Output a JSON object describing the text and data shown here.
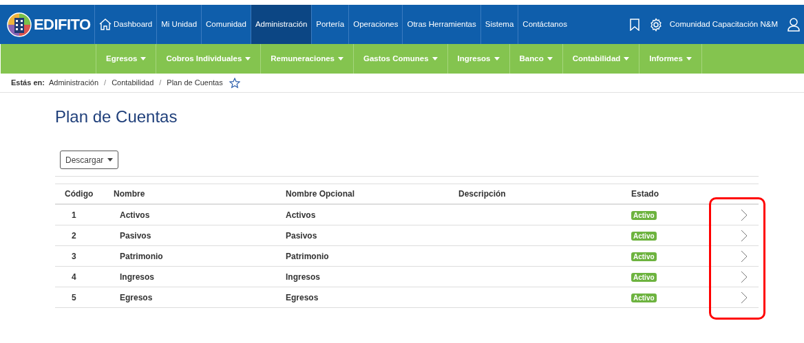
{
  "brand": {
    "name": "EDIFITO"
  },
  "top_nav": [
    {
      "label": "Dashboard",
      "kind": "home",
      "selected": false
    },
    {
      "label": "Mi Unidad",
      "selected": false
    },
    {
      "label": "Comunidad",
      "selected": false
    },
    {
      "label": "Administración",
      "selected": true
    },
    {
      "label": "Portería",
      "selected": false
    },
    {
      "label": "Operaciones",
      "selected": false
    },
    {
      "label": "Otras Herramientas",
      "selected": false
    },
    {
      "label": "Sistema",
      "selected": false
    },
    {
      "label": "Contáctanos",
      "selected": false
    }
  ],
  "user": {
    "community": "Comunidad Capacitación N&M"
  },
  "sub_nav": [
    "Egresos",
    "Cobros Individuales",
    "Remuneraciones",
    "Gastos Comunes",
    "Ingresos",
    "Banco",
    "Contabilidad",
    "Informes"
  ],
  "breadcrumb": {
    "prefix": "Estás en:",
    "items": [
      "Administración",
      "Contabilidad",
      "Plan de Cuentas"
    ],
    "separator": "/"
  },
  "page_title": "Plan de Cuentas",
  "download_button": "Descargar",
  "table": {
    "columns": [
      "Código",
      "Nombre",
      "Nombre Opcional",
      "Descripción",
      "Estado"
    ],
    "rows": [
      {
        "code": "1",
        "name": "Activos",
        "optional_name": "Activos",
        "status": "Activo"
      },
      {
        "code": "2",
        "name": "Pasivos",
        "optional_name": "Pasivos",
        "status": "Activo"
      },
      {
        "code": "3",
        "name": "Patrimonio",
        "optional_name": "Patrimonio",
        "status": "Activo"
      },
      {
        "code": "4",
        "name": "Ingresos",
        "optional_name": "Ingresos",
        "status": "Activo"
      },
      {
        "code": "5",
        "name": "Egresos",
        "optional_name": "Egresos",
        "status": "Activo"
      }
    ]
  },
  "highlight": {
    "kind": "outline"
  }
}
